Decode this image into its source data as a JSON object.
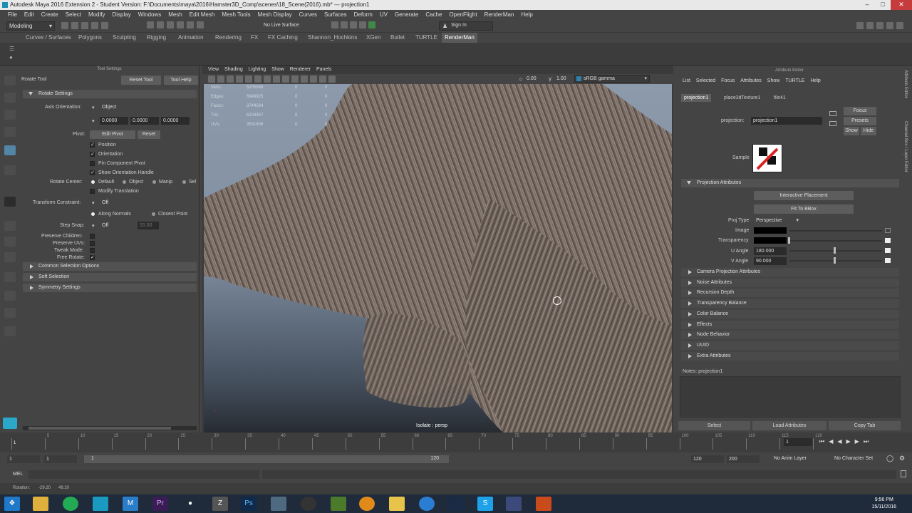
{
  "window": {
    "title": "Autodesk Maya 2016 Extension 2 - Student Version: F:\\Documents\\maya\\2016\\Hamster3D_Comp\\scenes\\18_Scene(2016).mb*   ---   projection1"
  },
  "menubar": [
    "File",
    "Edit",
    "Create",
    "Select",
    "Modify",
    "Display",
    "Windows",
    "Mesh",
    "Edit Mesh",
    "Mesh Tools",
    "Mesh Display",
    "Curves",
    "Surfaces",
    "Deform",
    "UV",
    "Generate",
    "Cache",
    "OpenFlight",
    "RenderMan",
    "Help"
  ],
  "statusline": {
    "mode": "Modeling",
    "live_surface": "No Live Surface",
    "sign_in": "Sign In"
  },
  "shelf_tabs": [
    {
      "label": "Curves / Surfaces"
    },
    {
      "label": "Polygons"
    },
    {
      "label": "Sculpting"
    },
    {
      "label": "Rigging"
    },
    {
      "label": "Animation"
    },
    {
      "label": "Rendering"
    },
    {
      "label": "FX"
    },
    {
      "label": "FX Caching"
    },
    {
      "label": "Shannon_Hochkins"
    },
    {
      "label": "XGen"
    },
    {
      "label": "Bullet"
    },
    {
      "label": "TURTLE"
    },
    {
      "label": "RenderMan"
    }
  ],
  "tool_settings": {
    "panel_title": "Tool Settings",
    "tool_name": "Rotate Tool",
    "reset_tool": "Reset Tool",
    "tool_help": "Tool Help",
    "section_rotate": "Rotate Settings",
    "axis_orientation_label": "Axis Orientation:",
    "axis_orientation_value": "Object",
    "axis_values": [
      "0.0000",
      "0.0000",
      "0.0000"
    ],
    "pivot_label": "Pivot:",
    "edit_pivot": "Edit Pivot",
    "reset": "Reset",
    "pivot_options": [
      "Position",
      "Orientation",
      "Pin Component Pivot",
      "Show Orientation Handle"
    ],
    "rotate_center_label": "Rotate Center:",
    "rotate_center_options": [
      "Default",
      "Object",
      "Manip",
      "Sel"
    ],
    "modify_translation": "Modify Translation",
    "transform_constraint_label": "Transform Constraint:",
    "transform_constraint_value": "Off",
    "along_normals": "Along Normals",
    "closest_point": "Closest Point",
    "step_snap_label": "Step Snap:",
    "step_snap_value": "Off",
    "step_snap_num": "15.00",
    "preserve_children": "Preserve Children:",
    "preserve_uvs": "Preserve UVs:",
    "tweak_mode": "Tweak Mode:",
    "free_rotate": "Free Rotate:",
    "sections": [
      "Common Selection Options",
      "Soft Selection",
      "Symmetry Settings"
    ]
  },
  "viewport": {
    "menu": [
      "View",
      "Shading",
      "Lighting",
      "Show",
      "Renderer",
      "Panels"
    ],
    "exposure": "0.00",
    "gamma": "1.00",
    "color_space": "sRGB gamma",
    "hud": [
      {
        "k": "Verts:",
        "a": "5205998",
        "b": "0",
        "c": "0"
      },
      {
        "k": "Edges:",
        "a": "6949925",
        "b": "0",
        "c": "0"
      },
      {
        "k": "Faces:",
        "a": "3744034",
        "b": "0",
        "c": "0"
      },
      {
        "k": "Tris:",
        "a": "6204947",
        "b": "0",
        "c": "0"
      },
      {
        "k": "UVs:",
        "a": "3531806",
        "b": "0",
        "c": "0"
      }
    ],
    "isolate_label": "Isolate : persp"
  },
  "attribute_editor": {
    "panel_title": "Attribute Editor",
    "menu": [
      "List",
      "Selected",
      "Focus",
      "Attributes",
      "Show",
      "TURTLE",
      "Help"
    ],
    "tabs": [
      "projection1",
      "place3dTexture1",
      "file41"
    ],
    "node_label": "projection:",
    "node_value": "projection1",
    "focus": "Focus",
    "presets": "Presets",
    "show": "Show",
    "hide": "Hide",
    "sample_label": "Sample",
    "projection_section": "Projection Attributes",
    "interactive_placement": "Interactive Placement",
    "fit_bbox": "Fit To BBox",
    "proj_type_label": "Proj Type",
    "proj_type_value": "Perspective",
    "image_label": "Image",
    "transparency_label": "Transparency",
    "u_angle_label": "U Angle",
    "u_angle_value": "180.000",
    "v_angle_label": "V Angle",
    "v_angle_value": "90.000",
    "collapsed_sections": [
      "Camera Projection Attributes",
      "Noise Attributes",
      "Recursion Depth",
      "Transparency Balance",
      "Color Balance",
      "Effects",
      "Node Behavior",
      "UUID",
      "Extra Attributes"
    ],
    "notes": "Notes:  projection1",
    "select_btn": "Select",
    "load_attributes": "Load Attributes",
    "copy_tab": "Copy Tab",
    "side_labels": [
      "Attribute Editor",
      "Channel Box / Layer Editor"
    ]
  },
  "timeline": {
    "ticks": [
      "1",
      "5",
      "10",
      "15",
      "20",
      "25",
      "30",
      "35",
      "40",
      "45",
      "50",
      "55",
      "60",
      "65",
      "70",
      "75",
      "80",
      "85",
      "90",
      "95",
      "100",
      "105",
      "110",
      "115",
      "120"
    ],
    "current_frame": "1",
    "range_start": "1",
    "range_start2": "1",
    "range_slider_start": "1",
    "range_slider_end": "120",
    "range_end": "120",
    "range_end2": "200",
    "anim_layer": "No Anim Layer",
    "character_set": "No Character Set"
  },
  "command_line": {
    "label": "MEL"
  },
  "help_line": {
    "label": "Rotation:",
    "v1": "-29.20",
    "v2": "49.20"
  },
  "taskbar": {
    "time": "9:56 PM",
    "date": "15/11/2016"
  }
}
